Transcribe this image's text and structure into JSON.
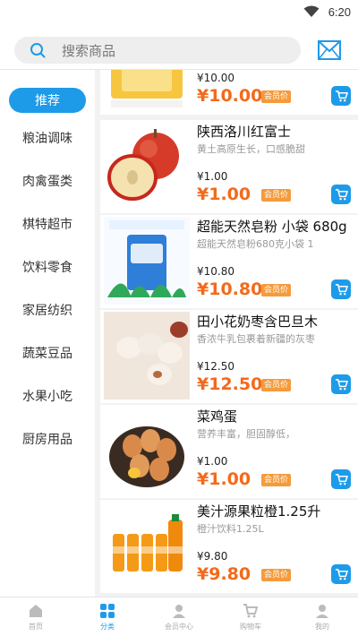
{
  "status": {
    "time": "6:20"
  },
  "search": {
    "placeholder": "搜索商品"
  },
  "categories": [
    {
      "label": "推荐",
      "active": true
    },
    {
      "label": "粮油调味"
    },
    {
      "label": "肉禽蛋类"
    },
    {
      "label": "棋特超市"
    },
    {
      "label": "饮料零食"
    },
    {
      "label": "家居纺织"
    },
    {
      "label": "蔬菜豆品"
    },
    {
      "label": "水果小吃"
    },
    {
      "label": "厨房用品"
    }
  ],
  "products": [
    {
      "title": "",
      "desc": "",
      "price": "¥10.00",
      "member_price": "¥10.00",
      "badge": "会员价"
    },
    {
      "title": "陕西洛川红富士",
      "desc": "黄土高原生长，口感脆甜",
      "price": "¥1.00",
      "member_price": "¥1.00",
      "badge": "会员价"
    },
    {
      "title": "超能天然皂粉 小袋 680g",
      "desc": "超能天然皂粉680克小袋 1",
      "price": "¥10.80",
      "member_price": "¥10.80",
      "badge": "会员价"
    },
    {
      "title": "田小花奶枣含巴旦木",
      "desc": "香浓牛乳包裹着新疆的灰枣",
      "price": "¥12.50",
      "member_price": "¥12.50",
      "badge": "会员价"
    },
    {
      "title": "菜鸡蛋",
      "desc": "营养丰富，胆固醇低，",
      "price": "¥1.00",
      "member_price": "¥1.00",
      "badge": "会员价"
    },
    {
      "title": "美汁源果粒橙1.25升",
      "desc": "橙汁饮料1.25L",
      "price": "¥9.80",
      "member_price": "¥9.80",
      "badge": "会员价"
    }
  ],
  "tabs": [
    {
      "label": "首页",
      "icon": "home-icon"
    },
    {
      "label": "分类",
      "icon": "category-icon",
      "active": true
    },
    {
      "label": "会员中心",
      "icon": "member-icon"
    },
    {
      "label": "购物车",
      "icon": "cart-icon"
    },
    {
      "label": "我的",
      "icon": "user-icon"
    }
  ],
  "colors": {
    "accent": "#1e9be8",
    "price": "#f36a1a",
    "badge": "#f49b3c"
  }
}
